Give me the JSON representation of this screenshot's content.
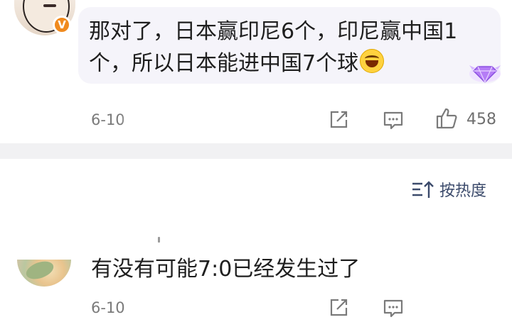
{
  "comment1": {
    "avatar": "user-avatar-sketch-face",
    "badge_icon": "verified-v-badge",
    "text": "那对了，日本赢印尼6个，印尼赢中国1个，所以日本能进中国7个球",
    "emoji": "laugh-cry-emoji",
    "member_badge": "diamond-member-badge",
    "time": "6-10",
    "share_icon": "share-icon",
    "comment_icon": "comment-icon",
    "like_icon": "thumb-up-icon",
    "like_count": "458"
  },
  "sort": {
    "icon": "sort-icon",
    "label": "按热度"
  },
  "comment2": {
    "avatar": "user-avatar-illustration",
    "text": "有没有可能7:0已经发生过了",
    "time": "6-10",
    "share_icon": "share-icon",
    "comment_icon": "comment-icon"
  },
  "colors": {
    "bubble_bg": "#f5f4fa",
    "divider": "#f1f1f3",
    "badge_orange": "#f08a1e",
    "sort_label": "#3b4a6b"
  }
}
